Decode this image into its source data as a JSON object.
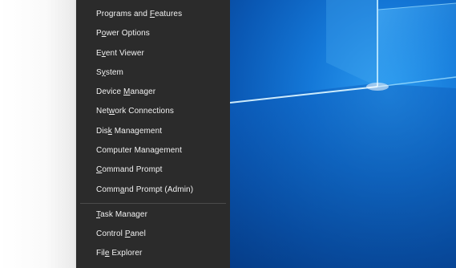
{
  "context_menu": {
    "items": [
      {
        "label": "Programs and Features",
        "key": "F"
      },
      {
        "label": "Power Options",
        "key": "O"
      },
      {
        "label": "Event Viewer",
        "key": "V"
      },
      {
        "label": "System",
        "key": "Y"
      },
      {
        "label": "Device Manager",
        "key": "M"
      },
      {
        "label": "Network Connections",
        "key": "W"
      },
      {
        "label": "Disk Management",
        "key": "K"
      },
      {
        "label": "Computer Management",
        "key": "G"
      },
      {
        "label": "Command Prompt",
        "key": "C"
      },
      {
        "label": "Command Prompt (Admin)",
        "key": "A"
      },
      {
        "label": "Task Manager",
        "key": "T"
      },
      {
        "label": "Control Panel",
        "key": "P"
      },
      {
        "label": "File Explorer",
        "key": "E"
      }
    ]
  },
  "desktop": {
    "wallpaper": "windows-10-hero-light",
    "colors": {
      "base": "#0a58b4",
      "glow": "#2c9cf0",
      "beam": "#9fe0ff"
    }
  },
  "theme": {
    "menu_bg": "#2b2b2b",
    "menu_text": "#f2f2f2",
    "separator": "#4a4a4a"
  }
}
